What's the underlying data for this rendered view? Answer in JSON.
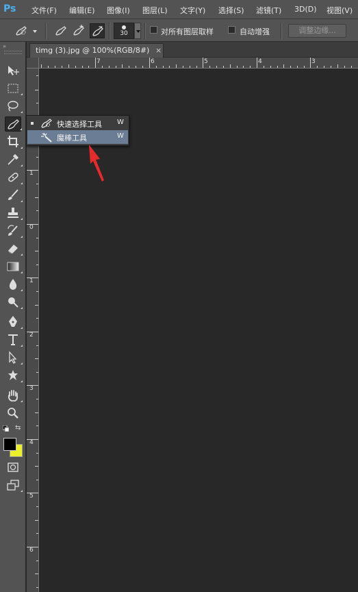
{
  "app": {
    "logo": "Ps"
  },
  "menubar": {
    "items": [
      "文件(F)",
      "编辑(E)",
      "图像(I)",
      "图层(L)",
      "文字(Y)",
      "选择(S)",
      "滤镜(T)",
      "3D(D)",
      "视图(V)"
    ]
  },
  "options": {
    "brush_size": "30",
    "sample_all_layers_label": "对所有图层取样",
    "auto_enhance_label": "自动增强",
    "refine_edge_label": "调整边缘..."
  },
  "document": {
    "tab_title": "timg (3).jpg @ 100%(RGB/8#)",
    "close_glyph": "×"
  },
  "rulers": {
    "horizontal": [
      "7",
      "6",
      "5",
      "4",
      "3"
    ],
    "vertical": [
      "1",
      "0",
      "1",
      "2",
      "3",
      "4",
      "5",
      "6"
    ]
  },
  "flyout": {
    "items": [
      {
        "label": "快速选择工具",
        "shortcut": "W",
        "icon": "quick-selection-icon",
        "selected": true
      },
      {
        "label": "魔棒工具",
        "shortcut": "W",
        "icon": "magic-wand-icon",
        "highlighted": true
      }
    ]
  },
  "toolbox": {
    "tools": [
      "move-icon",
      "marquee-icon",
      "lasso-icon",
      "quick-selection-icon",
      "crop-icon",
      "eyedropper-icon",
      "healing-brush-icon",
      "brush-icon",
      "clone-stamp-icon",
      "history-brush-icon",
      "eraser-icon",
      "gradient-icon",
      "blur-icon",
      "dodge-icon",
      "pen-icon",
      "type-icon",
      "path-selection-icon",
      "shape-icon",
      "hand-icon",
      "zoom-icon",
      "quick-mask-icon",
      "screen-mode-icon"
    ],
    "foreground_color": "#000000",
    "background_color": "#ecf02a"
  },
  "colors": {
    "highlight": "#6a7d94",
    "arrow": "#e52b2b",
    "canvas": "#282828"
  }
}
